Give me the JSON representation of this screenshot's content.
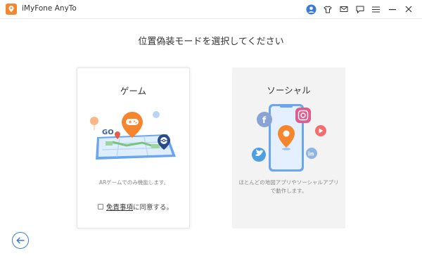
{
  "app": {
    "name": "iMyFone AnyTo"
  },
  "titlebar": {
    "icons": [
      "user-avatar-icon",
      "tshirt-icon",
      "mail-icon",
      "feedback-icon",
      "menu-icon",
      "minimize-icon",
      "close-icon"
    ]
  },
  "page": {
    "title": "位置偽装モードを選択してください"
  },
  "cards": {
    "game": {
      "title": "ゲーム",
      "description": "ARゲームでのみ機能します。",
      "agree_link": "免責事項",
      "agree_suffix": "に同意する。",
      "illustration_text": "GO"
    },
    "social": {
      "title": "ソーシャル",
      "description": "ほとんどの地図アプリやソーシャルアプリで動作します。"
    }
  },
  "colors": {
    "accent_orange": "#f5862e",
    "accent_blue": "#3a7bd5",
    "titlebar_border": "#e9e9e9",
    "social_card_bg": "#f3f3f3"
  }
}
